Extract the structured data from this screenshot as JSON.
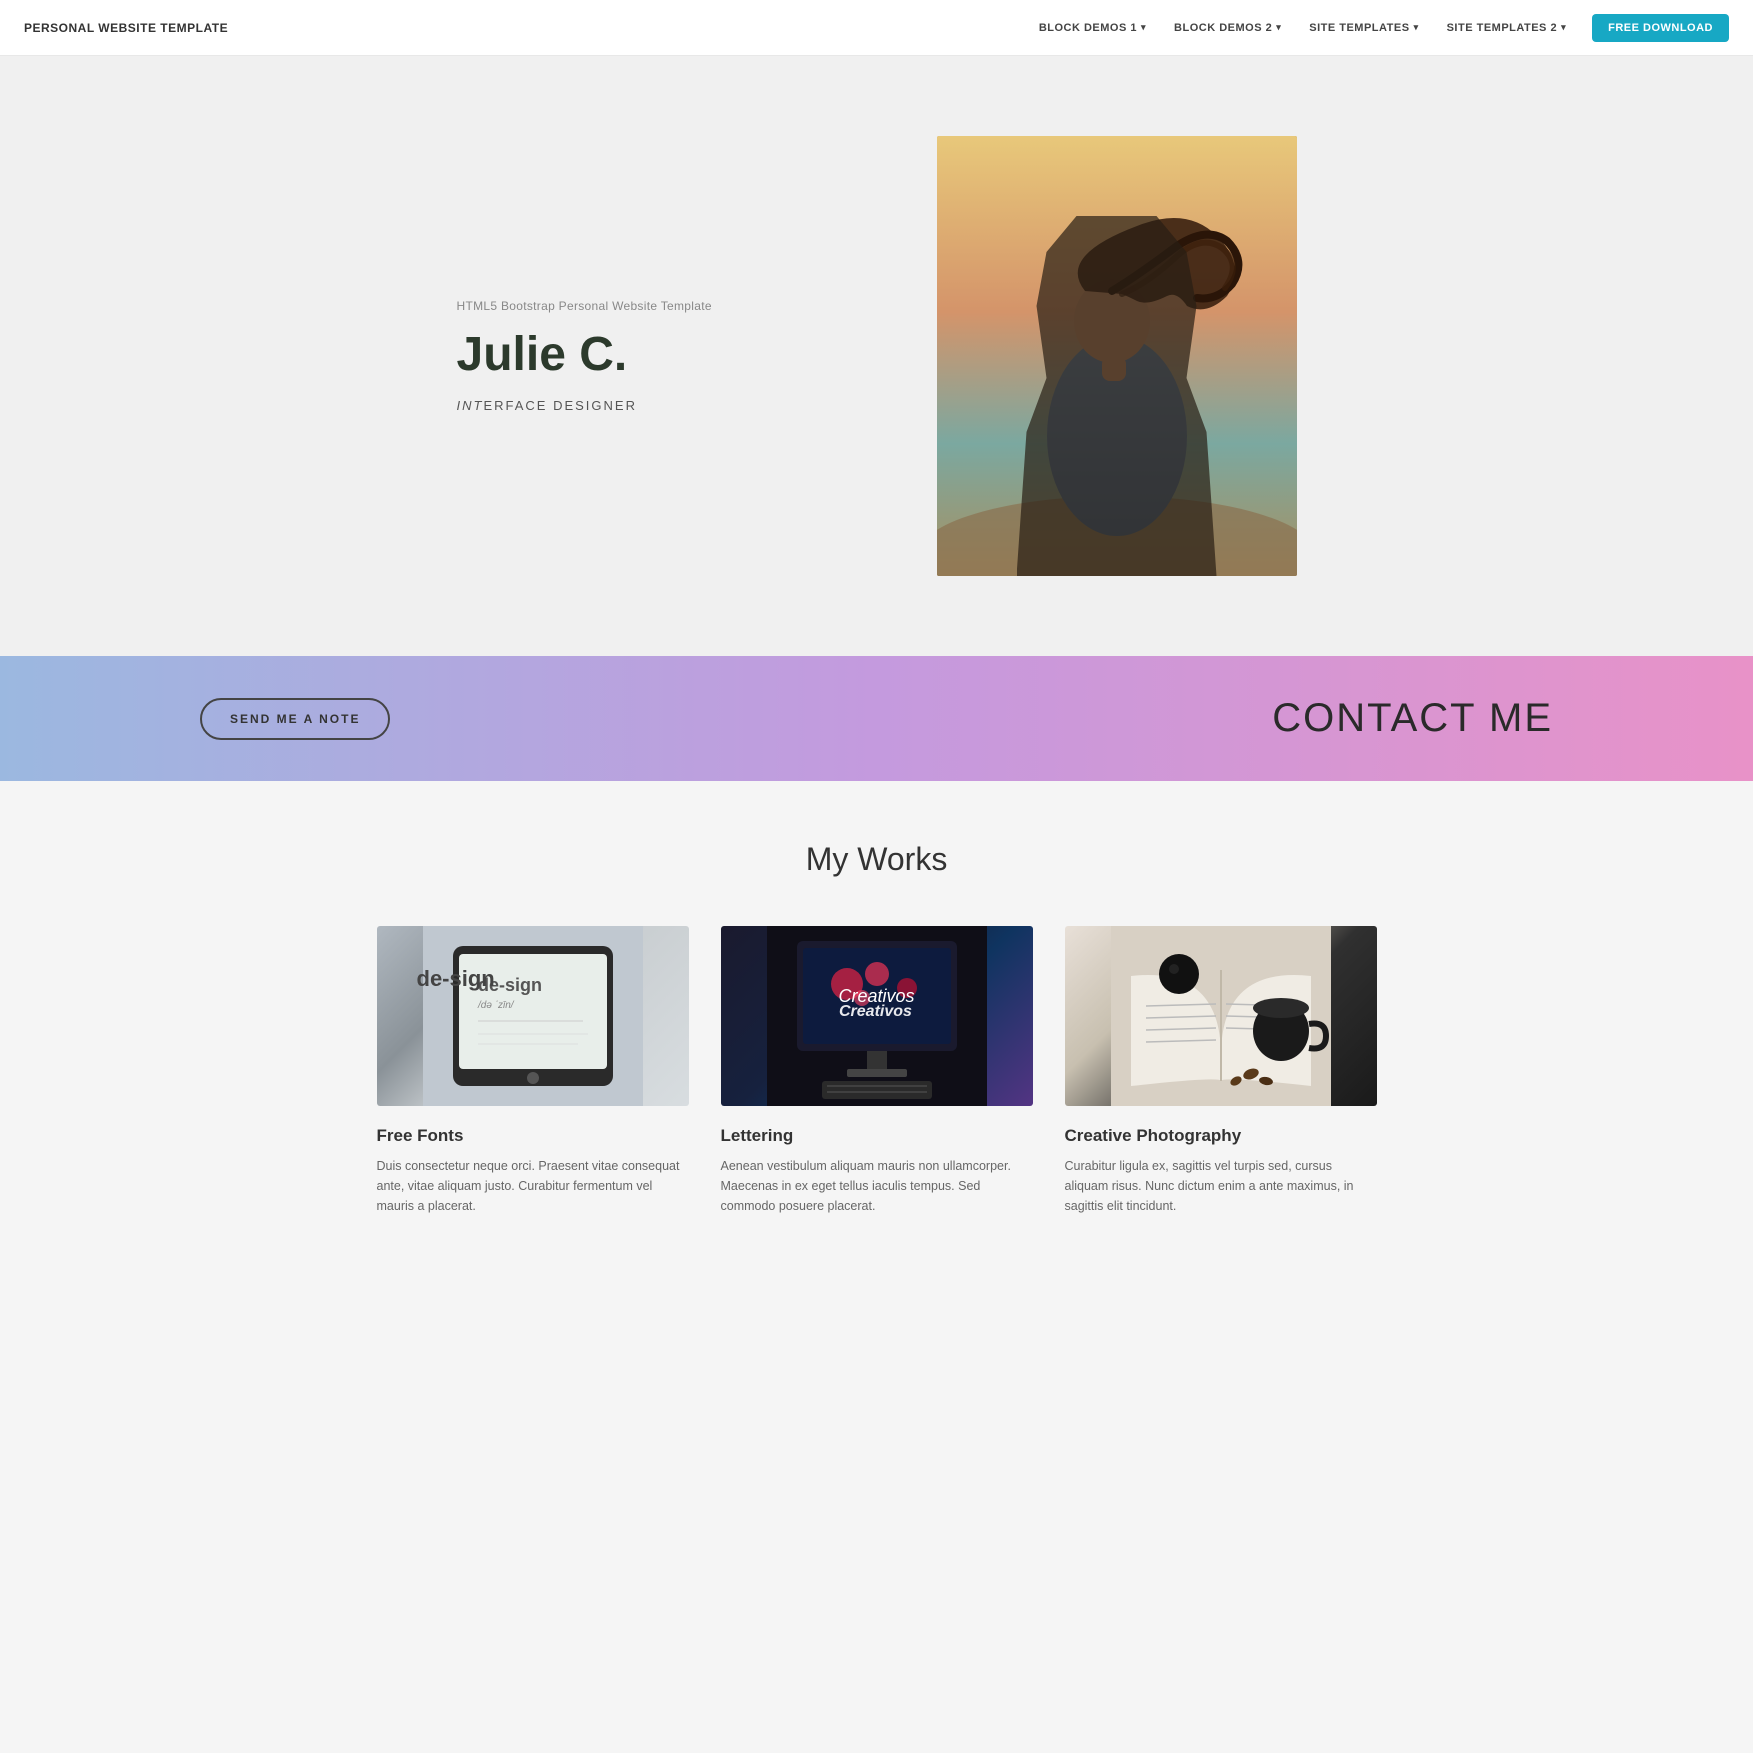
{
  "navbar": {
    "brand": "PERSONAL WEBSITE TEMPLATE",
    "links": [
      {
        "label": "BLOCK DEMOS 1",
        "hasDropdown": true
      },
      {
        "label": "BLOCK DEMOS 2",
        "hasDropdown": true
      },
      {
        "label": "SITE TEMPLATES",
        "hasDropdown": true
      },
      {
        "label": "SITE TEMPLATES 2",
        "hasDropdown": true
      }
    ],
    "cta": "FREE DOWNLOAD"
  },
  "hero": {
    "subtitle": "HTML5 Bootstrap Personal Website Template",
    "name": "Julie C.",
    "role": "INTERFACE DESIGNER",
    "role_styled": "INTERFACE DESIGNER"
  },
  "contact": {
    "button": "SEND ME A NOTE",
    "title": "CONTACT ME"
  },
  "works": {
    "heading": "My Works",
    "items": [
      {
        "title": "Free Fonts",
        "description": "Duis consectetur neque orci. Praesent vitae consequat ante, vitae aliquam justo. Curabitur fermentum vel mauris a placerat."
      },
      {
        "title": "Lettering",
        "description": "Aenean vestibulum aliquam mauris non ullamcorper. Maecenas in ex eget tellus iaculis tempus. Sed commodo posuere placerat."
      },
      {
        "title": "Creative Photography",
        "description": "Curabitur ligula ex, sagittis vel turpis sed, cursus aliquam risus. Nunc dictum enim a ante maximus, in sagittis elit tincidunt."
      }
    ]
  }
}
